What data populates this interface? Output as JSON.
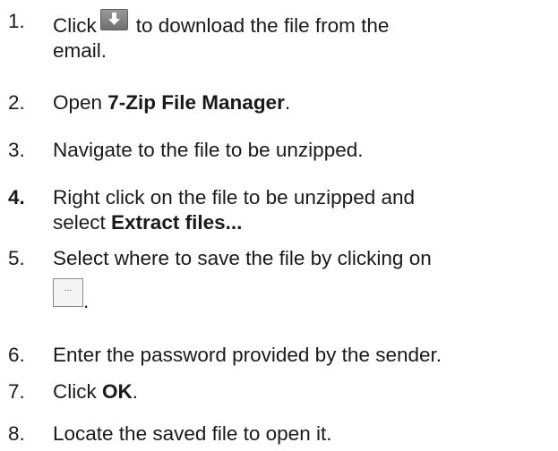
{
  "steps": [
    {
      "number": "1.",
      "parts": {
        "a": "Click",
        "b": "to download the file from the",
        "c": "email."
      },
      "icon": "download-arrow-icon"
    },
    {
      "number": "2.",
      "parts": {
        "a": "Open ",
        "b": "7-Zip File Manager",
        "c": "."
      }
    },
    {
      "number": "3.",
      "parts": {
        "a": "Navigate to the file to be unzipped."
      }
    },
    {
      "number": "4.",
      "parts": {
        "a": "Right click on the file to be unzipped and",
        "b": "select ",
        "c": "Extract files..."
      }
    },
    {
      "number": "5.",
      "parts": {
        "a": "Select where to save the file by clicking on",
        "b": "...",
        "c": "."
      },
      "icon": "browse-button-icon"
    },
    {
      "number": "6.",
      "parts": {
        "a": "Enter the password provided by the sender."
      }
    },
    {
      "number": "7.",
      "parts": {
        "a": "Click ",
        "b": "OK",
        "c": "."
      }
    },
    {
      "number": "8.",
      "parts": {
        "a": "Locate the saved file to open it."
      }
    }
  ]
}
